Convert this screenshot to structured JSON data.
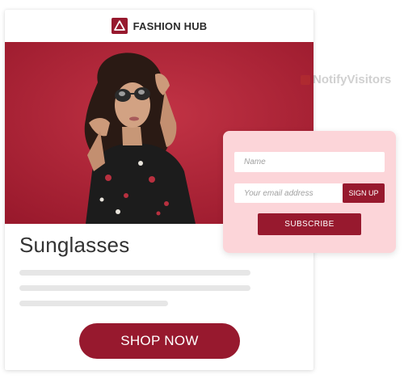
{
  "card": {
    "brand_name": "FASHION HUB",
    "hero_image": "woman-in-sunglasses-photo",
    "title": "Sunglasses",
    "shop_button": "SHOP NOW"
  },
  "popup": {
    "name_placeholder": "Name",
    "email_placeholder": "Your email address",
    "signup_button": "SIGN UP",
    "subscribe_button": "SUBSCRIBE"
  },
  "watermark": {
    "text": "NotifyVisitors"
  },
  "colors": {
    "brand": "#97192e",
    "hero_background": "#b4283a",
    "popup_background": "#fcd5d9",
    "placeholder_line": "#e6e6e6"
  }
}
